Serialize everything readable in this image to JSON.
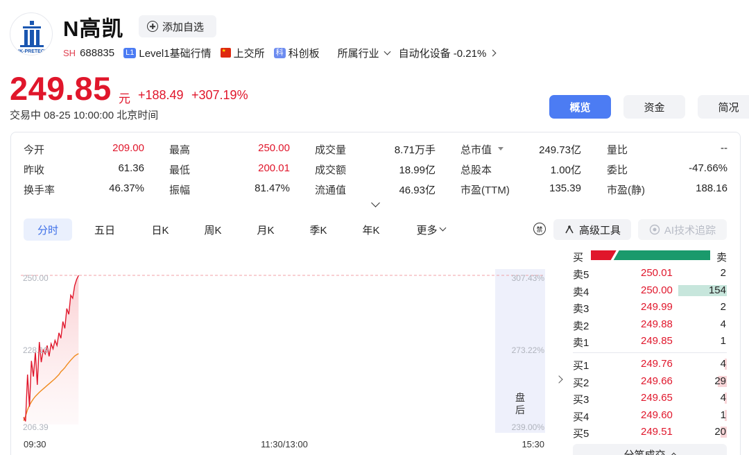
{
  "header": {
    "logo_text": "HK-PRETECH",
    "name": "N高凯",
    "add_watch_label": "添加自选",
    "market_badge": "SH",
    "code": "688835",
    "level_badge": "L1",
    "level_label": "Level1基础行情",
    "exchange_label": "上交所",
    "board_badge": "科",
    "board_label": "科创板",
    "industry_label": "所属行业",
    "industry_value": "自动化设备 -0.21%"
  },
  "quote": {
    "price": "249.85",
    "unit": "元",
    "change": "+188.49",
    "change_pct": "+307.19%",
    "status": "交易中 08-25 10:00:00 北京时间"
  },
  "tabs": {
    "overview": "概览",
    "funds": "资金",
    "profile": "简况"
  },
  "stats": [
    [
      {
        "label": "今开",
        "value": "209.00",
        "red": true
      },
      {
        "label": "最高",
        "value": "250.00",
        "red": true
      },
      {
        "label": "成交量",
        "value": "8.71万手",
        "red": false
      },
      {
        "label": "总市值",
        "value": "249.73亿",
        "red": false
      },
      {
        "label": "量比",
        "value": "--",
        "red": false
      }
    ],
    [
      {
        "label": "昨收",
        "value": "61.36",
        "red": false
      },
      {
        "label": "最低",
        "value": "200.01",
        "red": true
      },
      {
        "label": "成交额",
        "value": "18.99亿",
        "red": false
      },
      {
        "label": "总股本",
        "value": "1.00亿",
        "red": false
      },
      {
        "label": "委比",
        "value": "-47.66%",
        "red": false
      }
    ],
    [
      {
        "label": "换手率",
        "value": "46.37%",
        "red": false
      },
      {
        "label": "振幅",
        "value": "81.47%",
        "red": false
      },
      {
        "label": "流通值",
        "value": "46.93亿",
        "red": false
      },
      {
        "label": "市盈(TTM)",
        "value": "135.39",
        "red": false
      },
      {
        "label": "市盈(静)",
        "value": "188.16",
        "red": false
      }
    ]
  ],
  "period_tabs": [
    "分时",
    "五日",
    "日K",
    "周K",
    "月K",
    "季K",
    "年K",
    "更多"
  ],
  "tools": {
    "toggle_icon_text": "禁",
    "advanced": "高级工具",
    "ai": "AI技术追踪"
  },
  "order_book": {
    "buy_label": "买",
    "sell_label": "卖",
    "buy_ratio": 0.19,
    "asks": [
      {
        "label": "卖5",
        "price": "250.01",
        "volume": "2"
      },
      {
        "label": "卖4",
        "price": "250.00",
        "volume": "154"
      },
      {
        "label": "卖3",
        "price": "249.99",
        "volume": "2"
      },
      {
        "label": "卖2",
        "price": "249.88",
        "volume": "4"
      },
      {
        "label": "卖1",
        "price": "249.85",
        "volume": "1"
      }
    ],
    "bids": [
      {
        "label": "买1",
        "price": "249.76",
        "volume": "4"
      },
      {
        "label": "买2",
        "price": "249.66",
        "volume": "29"
      },
      {
        "label": "买3",
        "price": "249.65",
        "volume": "4"
      },
      {
        "label": "买4",
        "price": "249.60",
        "volume": "1"
      },
      {
        "label": "买5",
        "price": "249.51",
        "volume": "20"
      }
    ],
    "detail_label": "分笔成交"
  },
  "chart_data": {
    "type": "line",
    "y_left_ticks": [
      "250.00",
      "228.19",
      "206.39"
    ],
    "y_right_ticks": [
      "307.43%",
      "273.22%",
      "239.00%"
    ],
    "x_ticks": [
      "09:30",
      "11:30/13:00",
      "15:30"
    ],
    "after_hours_label": "盘后",
    "ylim": [
      206.39,
      250.0
    ],
    "total_minutes": 240,
    "price_series": [
      208.5,
      207.3,
      221.0,
      211.6,
      225.0,
      220.4,
      227.6,
      218.0,
      230.5,
      224.6,
      228.2,
      227.0,
      229.5,
      226.3,
      230.0,
      228.5,
      231.0,
      229.5,
      233.2,
      231.6,
      236.5,
      234.5,
      240.3,
      238.6,
      244.2,
      243.3,
      247.0,
      248.8,
      250.0
    ],
    "avg_series": [
      207.5,
      208.8,
      210.7,
      212.0,
      213.0,
      213.9,
      214.6,
      215.2,
      215.8,
      216.3,
      216.8,
      217.3,
      217.8,
      218.3,
      218.8,
      219.3,
      219.8,
      220.4,
      221.0,
      221.8,
      222.4,
      223.0,
      223.8,
      224.5,
      225.2,
      225.8,
      226.4,
      226.8,
      227.1
    ]
  }
}
